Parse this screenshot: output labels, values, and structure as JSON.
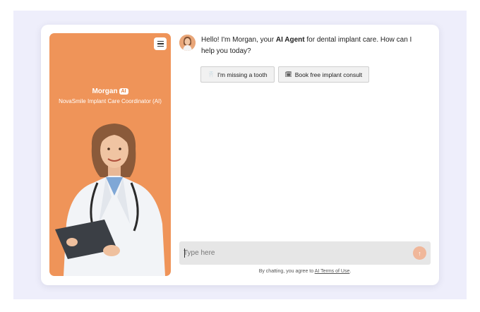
{
  "agent": {
    "name": "Morgan",
    "badge": "AI",
    "role": "NovaSmile Implant Care Coordinator (AI)"
  },
  "chat": {
    "greeting_pre": "Hello! I'm Morgan, your ",
    "greeting_bold": "AI Agent",
    "greeting_post": " for dental implant care. How can I help you today?",
    "quick_replies": [
      {
        "icon": "tooth-icon",
        "label": "I'm missing a tooth"
      },
      {
        "icon": "calendar-icon",
        "label": "Book free implant consult"
      }
    ]
  },
  "input": {
    "placeholder": "Type here",
    "send_icon": "arrow-up-icon"
  },
  "footer": {
    "terms_prefix": "By chatting, you agree to ",
    "terms_link": "AI Terms of Use",
    "terms_suffix": "."
  },
  "colors": {
    "panel": "#ef9459",
    "backdrop": "#eeeefb",
    "send": "#f0b79a"
  }
}
